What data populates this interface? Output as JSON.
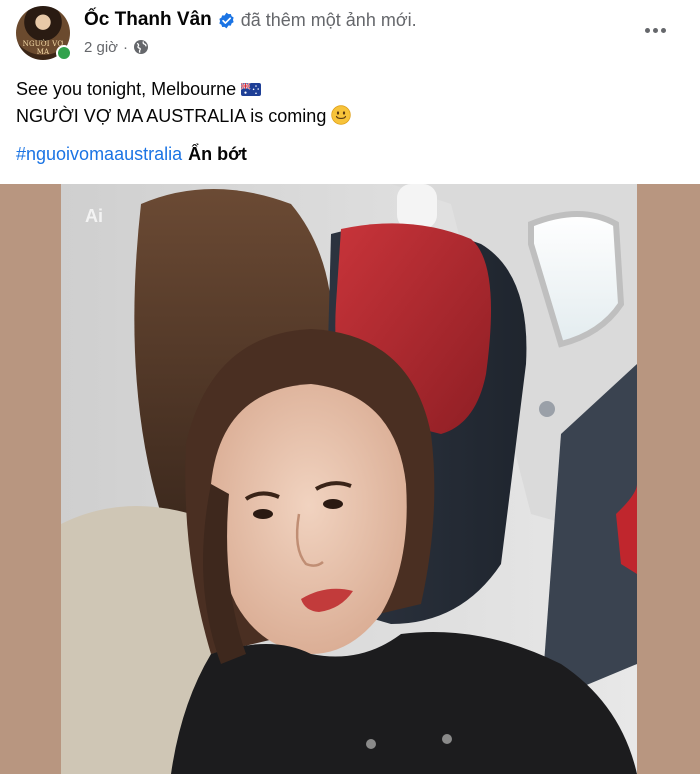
{
  "post": {
    "author": "Ốc Thanh Vân",
    "action": "đã thêm một ảnh mới.",
    "time": "2 giờ",
    "separator": "·",
    "avatar_text": "NGƯỜI VỢ MA",
    "text_line1": "See you tonight, Melbourne",
    "text_line2": "NGƯỜI VỢ MA AUSTRALIA is coming",
    "hashtag": "#nguoivomaaustralia",
    "see_less": "Ẩn bớt",
    "photo_watermark": "Ai"
  },
  "icons": {
    "verified": "verified-badge-icon",
    "privacy": "globe-icon",
    "more": "more-options-icon",
    "flag": "australia-flag-emoji",
    "smile": "smiling-face-emoji"
  },
  "colors": {
    "link": "#1b74e4",
    "secondary_text": "#65676b",
    "online": "#31a24c",
    "photo_backdrop": "#b89680"
  }
}
